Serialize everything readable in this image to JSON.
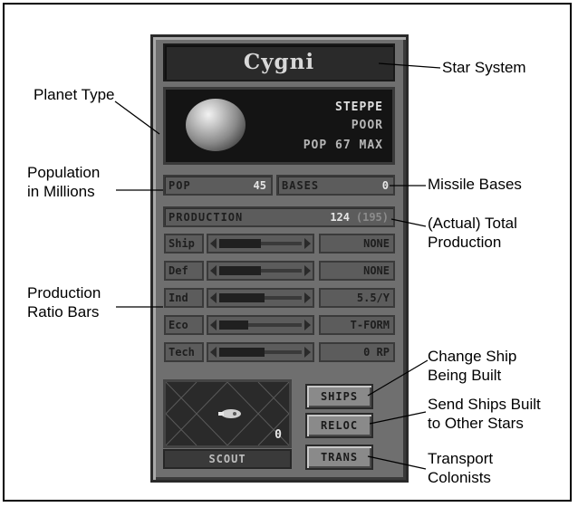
{
  "system": {
    "name": "Cygni"
  },
  "planet": {
    "type": "STEPPE",
    "quality": "POOR",
    "pop_max": "POP 67 MAX"
  },
  "stats": {
    "pop_label": "POP",
    "pop_value": "45",
    "bases_label": "BASES",
    "bases_value": "0",
    "production_label": "PRODUCTION",
    "production_actual": "124",
    "production_total": "(195)"
  },
  "allocation": [
    {
      "label": "Ship",
      "value": "NONE",
      "level": 0.5
    },
    {
      "label": "Def",
      "value": "NONE",
      "level": 0.5
    },
    {
      "label": "Ind",
      "value": "5.5/Y",
      "level": 0.55
    },
    {
      "label": "Eco",
      "value": "T-FORM",
      "level": 0.35
    },
    {
      "label": "Tech",
      "value": "0 RP",
      "level": 0.55
    }
  ],
  "ship": {
    "name": "SCOUT",
    "count": "0"
  },
  "buttons": {
    "ships": "SHIPS",
    "reloc": "RELOC",
    "trans": "TRANS"
  },
  "callouts": {
    "star_system": "Star System",
    "planet_type": "Planet Type",
    "population_1": "Population",
    "population_2": "in Millions",
    "missile_bases": "Missile Bases",
    "total_prod_1": "(Actual) Total",
    "total_prod_2": "Production",
    "ratio_1": "Production",
    "ratio_2": "Ratio Bars",
    "change_ship_1": "Change Ship",
    "change_ship_2": "Being Built",
    "send_ships_1": "Send Ships Built",
    "send_ships_2": "to Other Stars",
    "transport_1": "Transport",
    "transport_2": "Colonists"
  },
  "colors": {
    "panel": "#6f6f6f",
    "dark": "#2a2a2a",
    "text_light": "#e6e6e6"
  }
}
